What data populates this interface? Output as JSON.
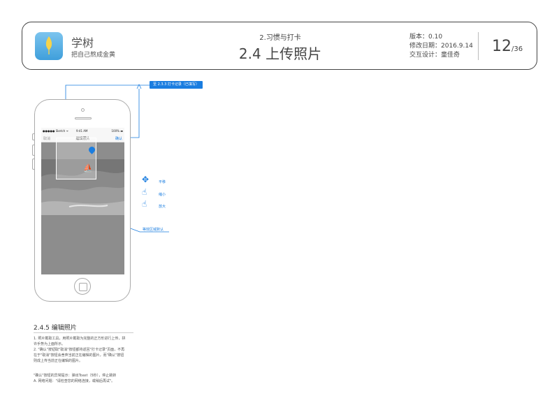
{
  "header": {
    "app_name": "学树",
    "app_slogan": "把自己熬成金黄",
    "section_sub": "2.习惯与打卡",
    "page_title": "2.4 上传照片",
    "version": "版本：0.10",
    "modified": "修改日期：2016.9.14",
    "designer": "交互设计：童佳奇",
    "page_number": "12",
    "page_total": "/36"
  },
  "tag": {
    "label": "至 2.3.3 打卡记录（已填写）"
  },
  "phone": {
    "status_carrier": "●●●●● Sketch ᯤ",
    "status_time": "9:41 AM",
    "status_battery": "100% ▬",
    "nav_cancel": "取消",
    "nav_title": "编辑照片",
    "nav_done": "确认"
  },
  "gestures": [
    {
      "label": "平移",
      "icon": "pan-hand-icon"
    },
    {
      "label": "缩小",
      "icon": "pinch-hand-icon"
    },
    {
      "label": "放大",
      "icon": "zoom-hand-icon"
    }
  ],
  "annotation": "等效区域默认",
  "section": {
    "title": "2.4.5 编辑照片",
    "paragraphs": [
      "1. 照片截取工具，用照片截取为完整的正方形进行上传，拼",
      "许手势为上面所示。",
      "2. \"确认\"按钮取\"取消\"按钮都将返回\"打卡记录\"页面，不再",
      "在于\"取消\"按钮会舍弃当前正在编辑的图片，而\"确认\"按钮",
      "则成上传当前正在编辑的图片。",
      "",
      "\"确认\"按钮的异常提示：弹出Toast（5秒），停止跳转",
      "A. 网络问题：\"请检查您的网络连接，或稍后再试\"。"
    ]
  }
}
